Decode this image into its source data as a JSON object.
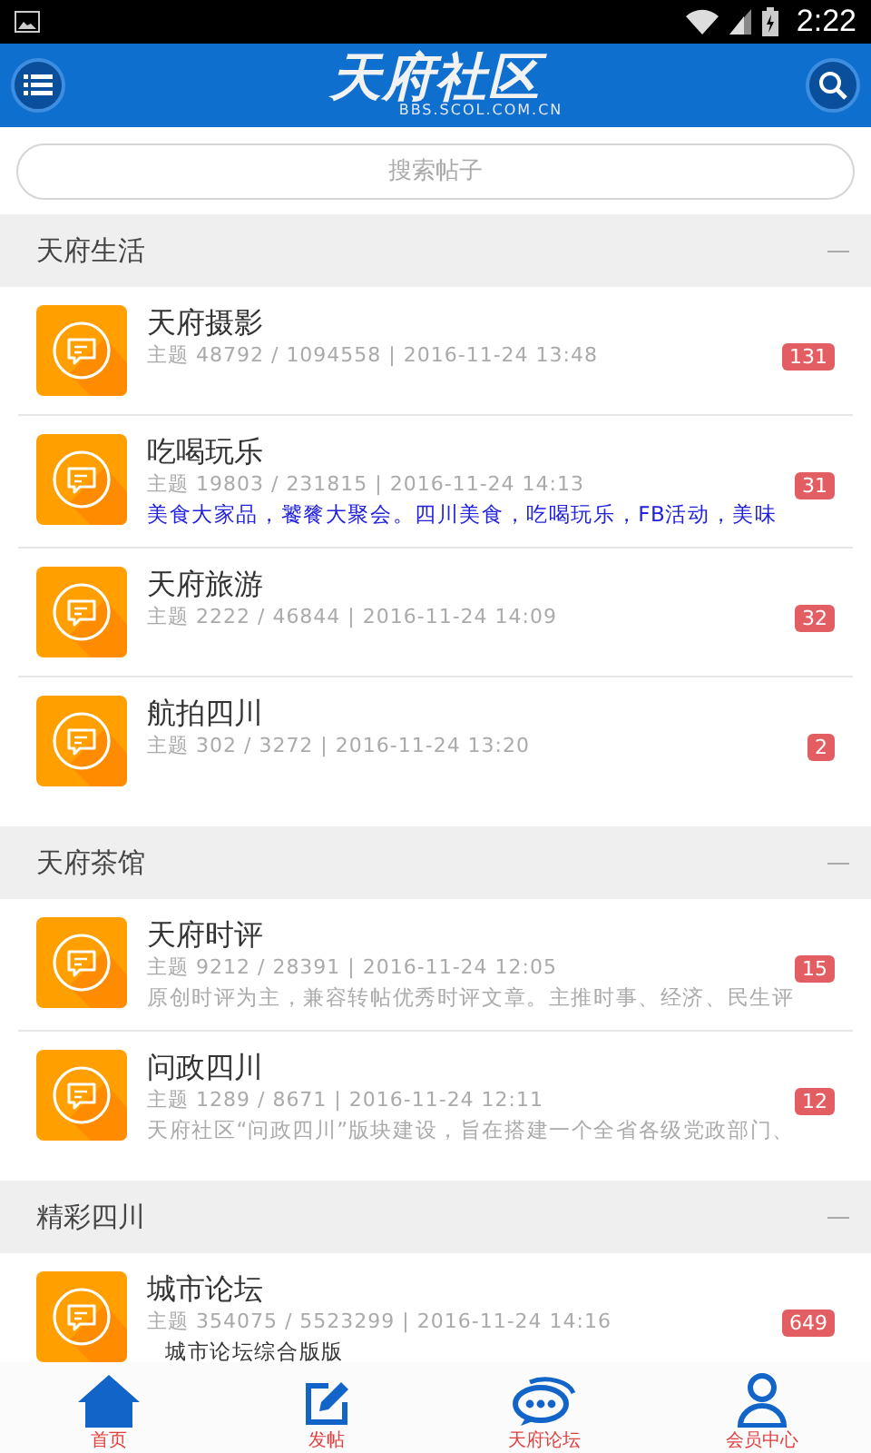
{
  "status_bar": {
    "time": "2:22"
  },
  "header": {
    "logo": "天府社区",
    "logo_sub": "BBS.SCOL.COM.CN"
  },
  "search": {
    "placeholder": "搜索帖子"
  },
  "sections": [
    {
      "title": "天府生活",
      "boards": [
        {
          "name": "天府摄影",
          "meta": "主题 48792 / 1094558 | 2016-11-24 13:48",
          "badge": "131"
        },
        {
          "name": "吃喝玩乐",
          "meta": "主题 19803 / 231815 | 2016-11-24 14:13",
          "badge": "31",
          "description": {
            "text": "美食大家品，饕餮大聚会。四川美食，吃喝玩乐，FB活动，美味",
            "color": "#2222dd"
          }
        },
        {
          "name": "天府旅游",
          "meta": "主题 2222 / 46844 | 2016-11-24 14:09",
          "badge": "32"
        },
        {
          "name": "航拍四川",
          "meta": "主题 302 / 3272 | 2016-11-24 13:20",
          "badge": "2"
        }
      ]
    },
    {
      "title": "天府茶馆",
      "boards": [
        {
          "name": "天府时评",
          "meta": "主题 9212 / 28391 | 2016-11-24 12:05",
          "badge": "15",
          "description": {
            "text": "原创时评为主，兼容转帖优秀时评文章。主推时事、经济、民生评",
            "color": "#aaaaaa"
          }
        },
        {
          "name": "问政四川",
          "meta": "主题 1289 / 8671 | 2016-11-24 12:11",
          "badge": "12",
          "description": {
            "text": "天府社区“问政四川”版块建设，旨在搭建一个全省各级党政部门、",
            "color": "#aaaaaa"
          }
        }
      ]
    },
    {
      "title": "精彩四川",
      "boards": [
        {
          "name": "城市论坛",
          "meta": "主题 354075 / 5523299 | 2016-11-24 14:16",
          "badge": "649",
          "description": {
            "text": "城市论坛综合版版",
            "color": "#333333"
          }
        }
      ]
    }
  ],
  "nav": [
    {
      "label": "首页",
      "kind": "home"
    },
    {
      "label": "发帖",
      "kind": "post"
    },
    {
      "label": "天府论坛",
      "kind": "forum"
    },
    {
      "label": "会员中心",
      "kind": "member"
    }
  ]
}
